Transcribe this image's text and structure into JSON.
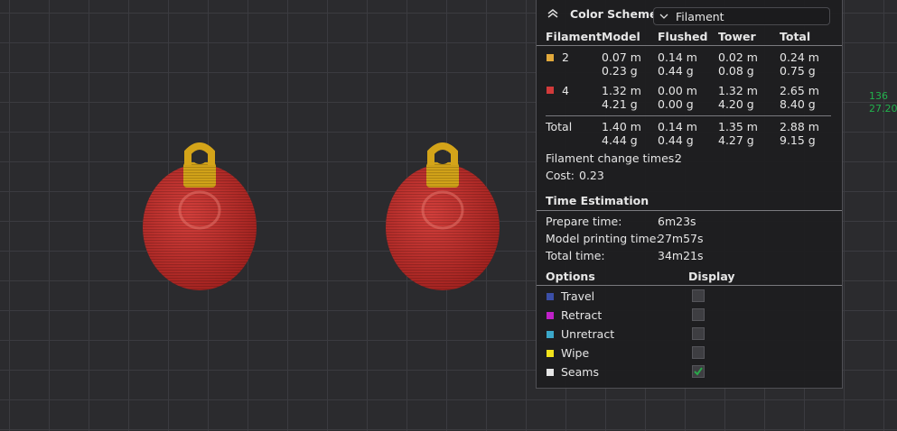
{
  "viewport": {
    "coordinate_readout": [
      "136",
      "27.20"
    ]
  },
  "panel": {
    "color_scheme_label": "Color Scheme",
    "color_scheme_value": "Filament",
    "headers": [
      "Filament",
      "Model",
      "Flushed",
      "Tower",
      "Total"
    ],
    "rows": [
      {
        "id": "2",
        "color": "#e2a93b",
        "model": [
          "0.07 m",
          "0.23 g"
        ],
        "flushed": [
          "0.14 m",
          "0.44 g"
        ],
        "tower": [
          "0.02 m",
          "0.08 g"
        ],
        "total": [
          "0.24 m",
          "0.75 g"
        ]
      },
      {
        "id": "4",
        "color": "#d23a3a",
        "model": [
          "1.32 m",
          "4.21 g"
        ],
        "flushed": [
          "0.00 m",
          "0.00 g"
        ],
        "tower": [
          "1.32 m",
          "4.20 g"
        ],
        "total": [
          "2.65 m",
          "8.40 g"
        ]
      }
    ],
    "total_row": {
      "label": "Total",
      "model": [
        "1.40 m",
        "4.44 g"
      ],
      "flushed": [
        "0.14 m",
        "0.44 g"
      ],
      "tower": [
        "1.35 m",
        "4.27 g"
      ],
      "total": [
        "2.88 m",
        "9.15 g"
      ]
    },
    "filament_change_label": "Filament change times:",
    "filament_change_value": "2",
    "cost_label": "Cost:",
    "cost_value": "0.23",
    "time_heading": "Time Estimation",
    "times": [
      {
        "label": "Prepare time:",
        "value": "6m23s"
      },
      {
        "label": "Model printing time:",
        "value": "27m57s"
      },
      {
        "label": "Total time:",
        "value": "34m21s"
      }
    ],
    "options_heading": "Options",
    "display_heading": "Display",
    "options": [
      {
        "label": "Travel",
        "color": "#3b4fa8",
        "checked": false
      },
      {
        "label": "Retract",
        "color": "#c021c9",
        "checked": false
      },
      {
        "label": "Unretract",
        "color": "#3ba7c9",
        "checked": false
      },
      {
        "label": "Wipe",
        "color": "#f2e21b",
        "checked": false
      },
      {
        "label": "Seams",
        "color": "#e6e6e6",
        "checked": true
      }
    ]
  },
  "colors": {
    "ornament_body": "#c0302e",
    "ornament_cap": "#d4a419",
    "check": "#2aa84a"
  }
}
